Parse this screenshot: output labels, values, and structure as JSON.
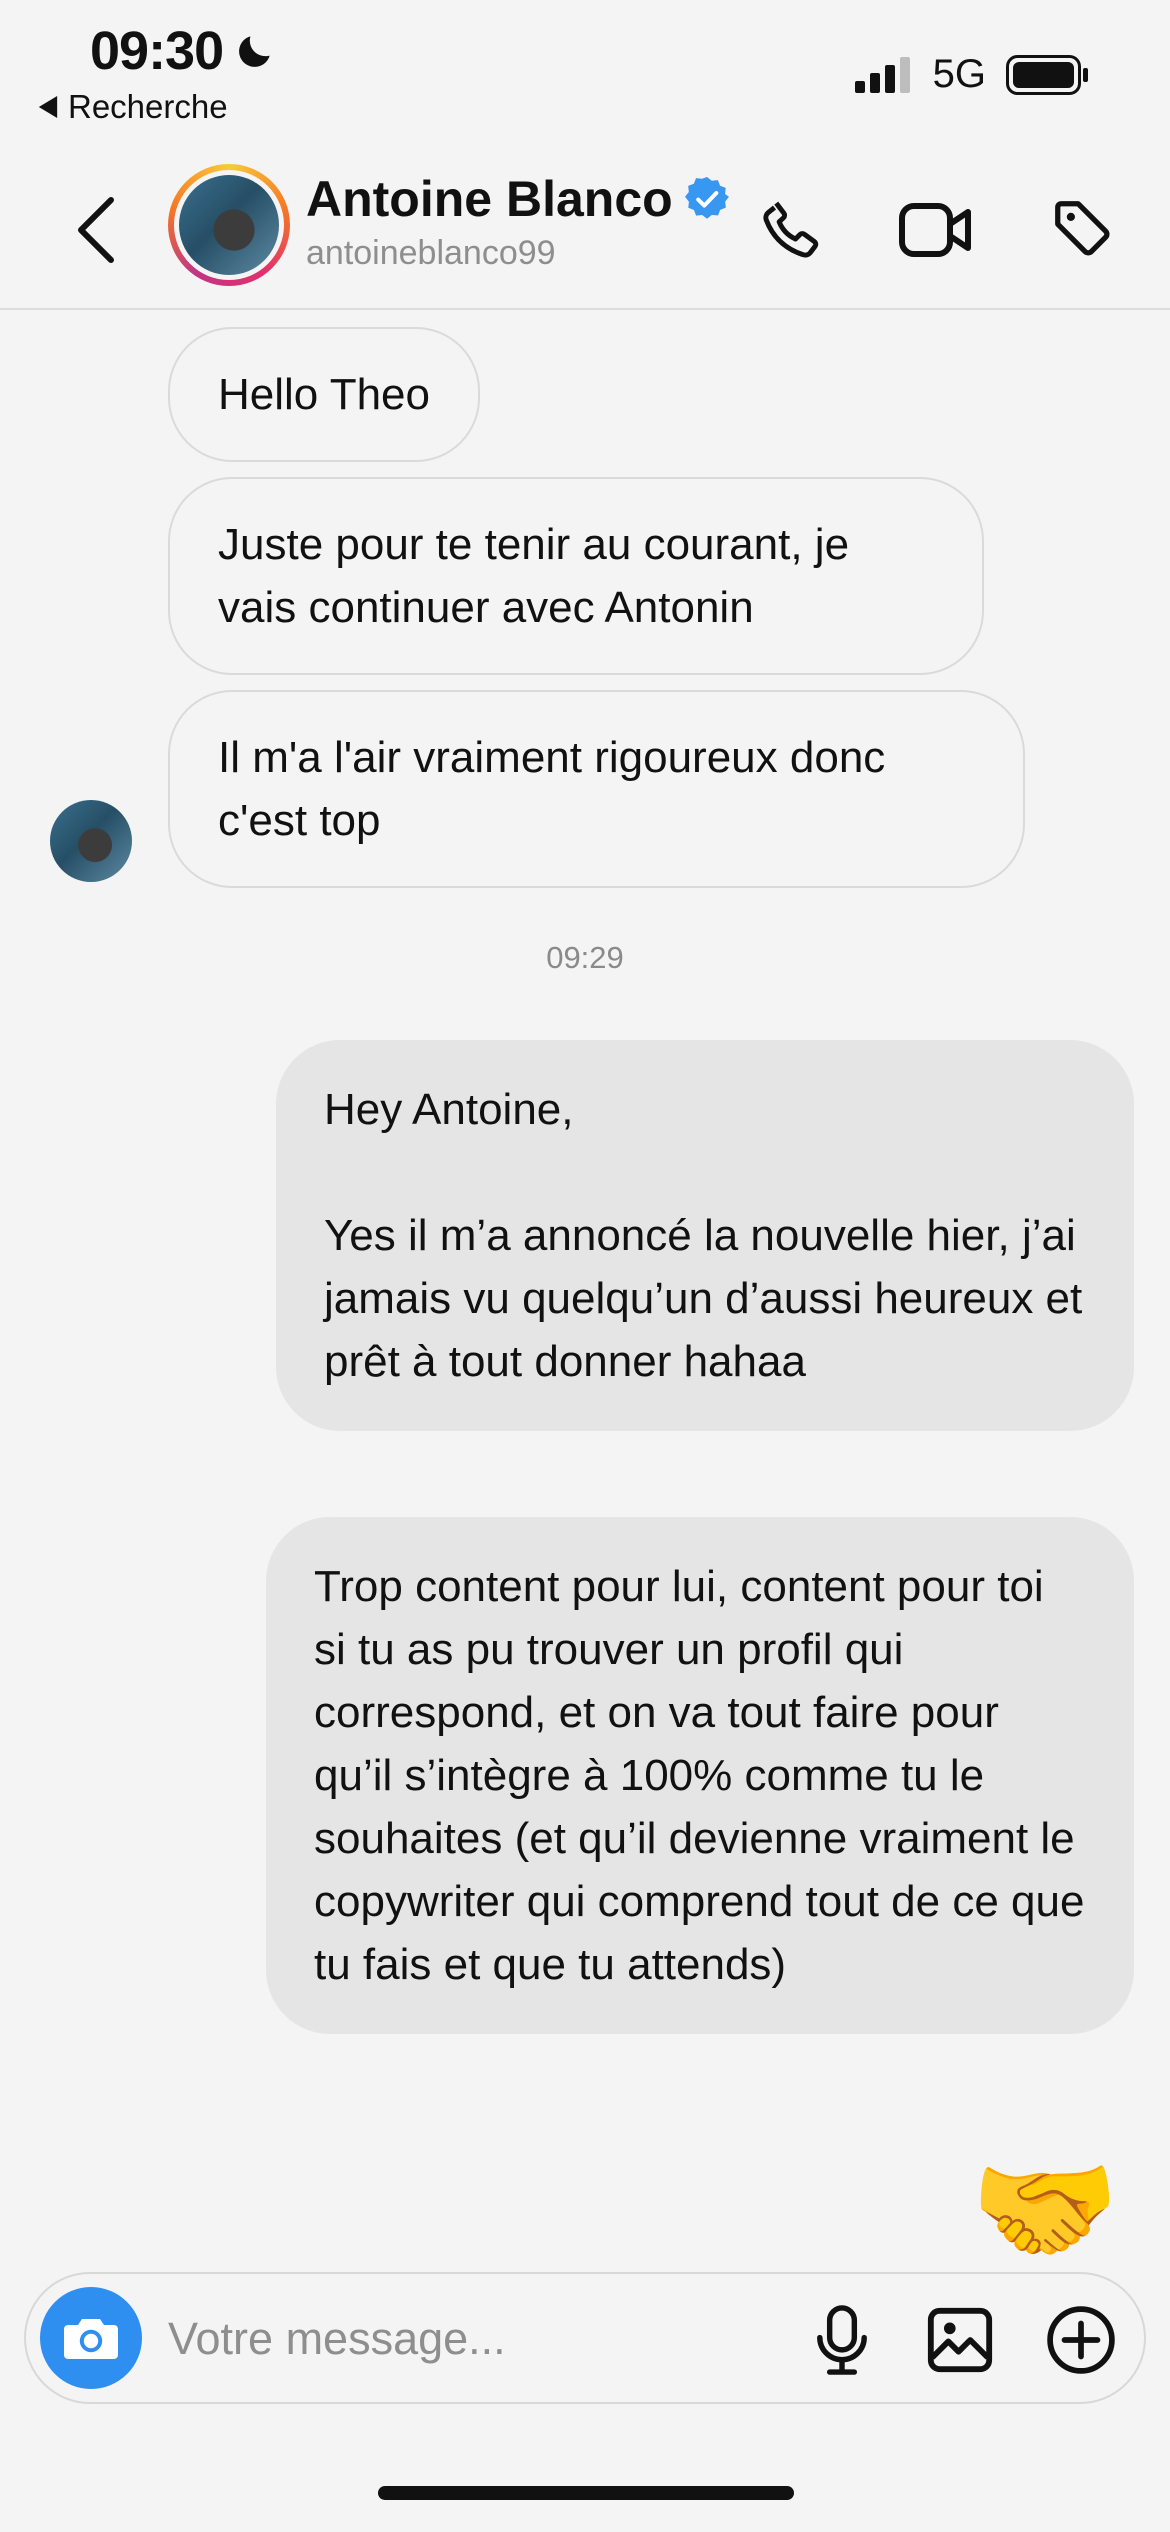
{
  "status_bar": {
    "time": "09:30",
    "back_app": "Recherche",
    "network": "5G"
  },
  "header": {
    "name": "Antoine Blanco",
    "username": "antoineblanco99",
    "verified": true
  },
  "messages": {
    "incoming": [
      "Hello Theo",
      "Juste pour te tenir au courant, je vais continuer avec Antonin",
      "Il m'a l'air vraiment rigoureux donc c'est top"
    ],
    "timestamp": "09:29",
    "outgoing": [
      "Hey Antoine,\n\nYes il m’a annoncé la nouvelle hier, j’ai jamais vu quelqu’un d’aussi heureux et prêt à tout donner hahaa",
      "Trop content pour lui, content pour toi si tu as pu trouver un profil qui correspond, et on va tout faire pour qu’il s’intègre à 100% comme tu le souhaites (et qu’il devienne vraiment le copywriter qui comprend tout de ce que tu fais et que tu attends)"
    ],
    "reaction_emoji": "🤝"
  },
  "composer": {
    "placeholder": "Votre message..."
  },
  "colors": {
    "background": "#f4f4f4",
    "outgoing_bubble": "#e5e5e5",
    "incoming_border": "#dadada",
    "verified_blue": "#3897f0",
    "camera_button": "#2f8ff0"
  },
  "icons": [
    "moon-icon",
    "signal-icon",
    "battery-icon",
    "back-arrow-icon",
    "verified-badge-icon",
    "phone-icon",
    "video-icon",
    "tag-icon",
    "camera-icon",
    "microphone-icon",
    "image-icon",
    "add-icon"
  ]
}
